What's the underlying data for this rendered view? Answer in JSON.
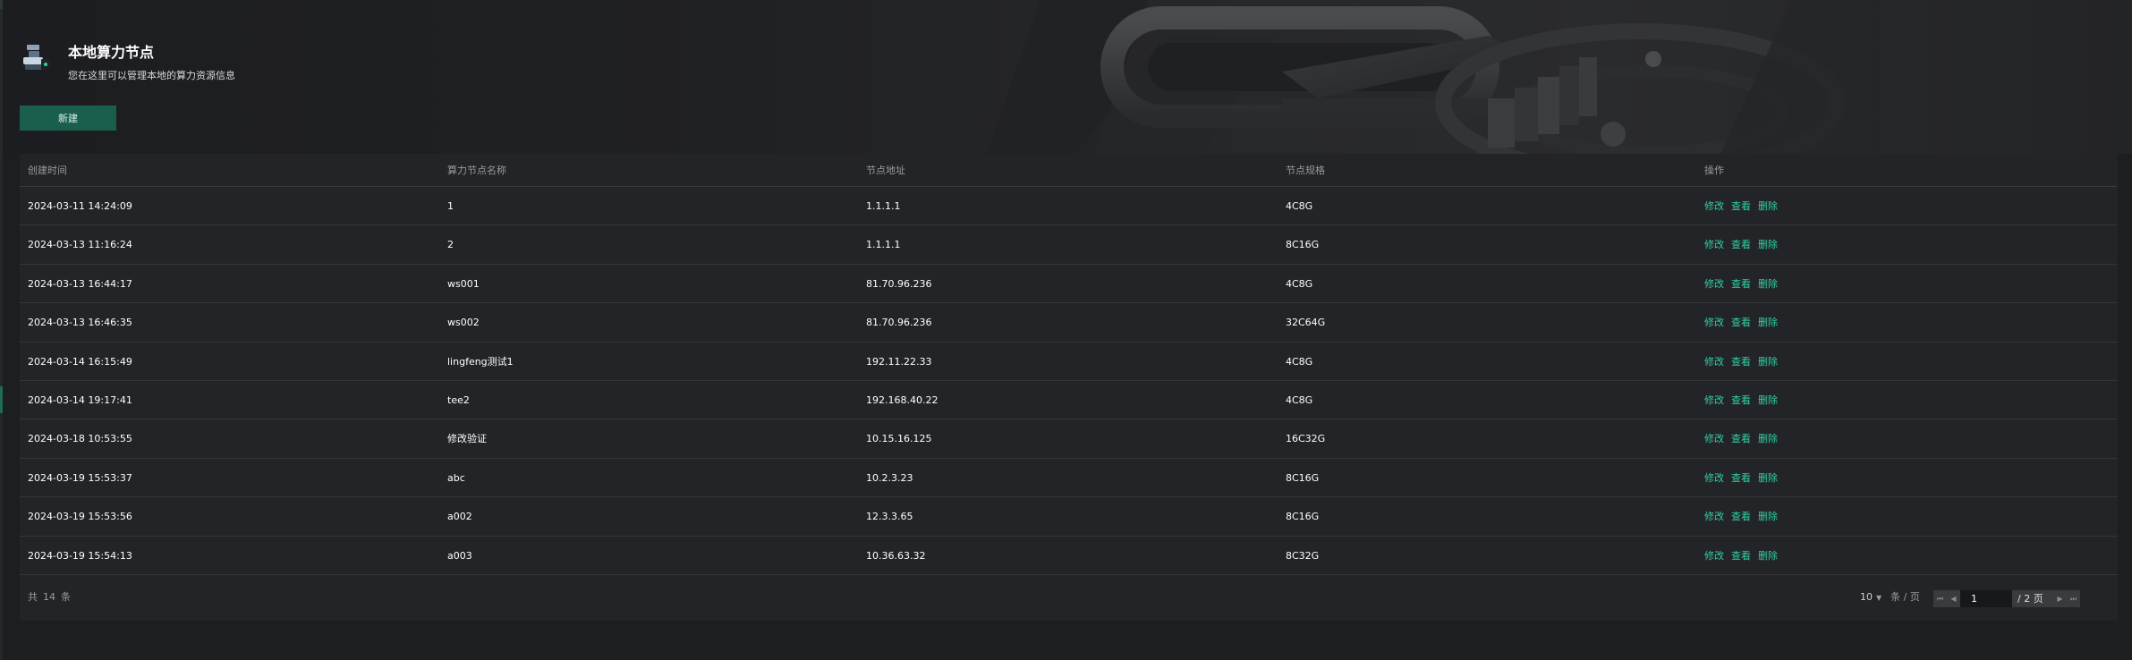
{
  "header": {
    "title": "本地算力节点",
    "subtitle": "您在这里可以管理本地的算力资源信息",
    "new_label": "新建"
  },
  "table": {
    "columns": [
      "创建时间",
      "算力节点名称",
      "节点地址",
      "节点规格",
      "操作"
    ],
    "rows": [
      {
        "created": "2024-03-11 14:24:09",
        "name": "1",
        "address": "1.1.1.1",
        "spec": "4C8G"
      },
      {
        "created": "2024-03-13 11:16:24",
        "name": "2",
        "address": "1.1.1.1",
        "spec": "8C16G"
      },
      {
        "created": "2024-03-13 16:44:17",
        "name": "ws001",
        "address": "81.70.96.236",
        "spec": "4C8G"
      },
      {
        "created": "2024-03-13 16:46:35",
        "name": "ws002",
        "address": "81.70.96.236",
        "spec": "32C64G"
      },
      {
        "created": "2024-03-14 16:15:49",
        "name": "lingfeng测试1",
        "address": "192.11.22.33",
        "spec": "4C8G"
      },
      {
        "created": "2024-03-14 19:17:41",
        "name": "tee2",
        "address": "192.168.40.22",
        "spec": "4C8G"
      },
      {
        "created": "2024-03-18 10:53:55",
        "name": "修改验证",
        "address": "10.15.16.125",
        "spec": "16C32G"
      },
      {
        "created": "2024-03-19 15:53:37",
        "name": "abc",
        "address": "10.2.3.23",
        "spec": "8C16G"
      },
      {
        "created": "2024-03-19 15:53:56",
        "name": "a002",
        "address": "12.3.3.65",
        "spec": "8C16G"
      },
      {
        "created": "2024-03-19 15:54:13",
        "name": "a003",
        "address": "10.36.63.32",
        "spec": "8C32G"
      }
    ],
    "actions": {
      "edit": "修改",
      "view": "查看",
      "delete": "删除"
    }
  },
  "footer": {
    "total_prefix": "共",
    "total_count": "14",
    "total_suffix": "条",
    "page_size": "10",
    "page_size_unit": "条 / 页",
    "current_page": "1",
    "total_pages": "/ 2 页"
  },
  "icons": {
    "first": "first-page-icon",
    "prev": "prev-page-icon",
    "next": "next-page-icon",
    "last": "last-page-icon",
    "caret": "chevron-down-icon"
  },
  "colors": {
    "accent": "#2fd0a4",
    "button_bg": "#1a5f4e",
    "background": "#1d1e21",
    "card": "#232427"
  }
}
